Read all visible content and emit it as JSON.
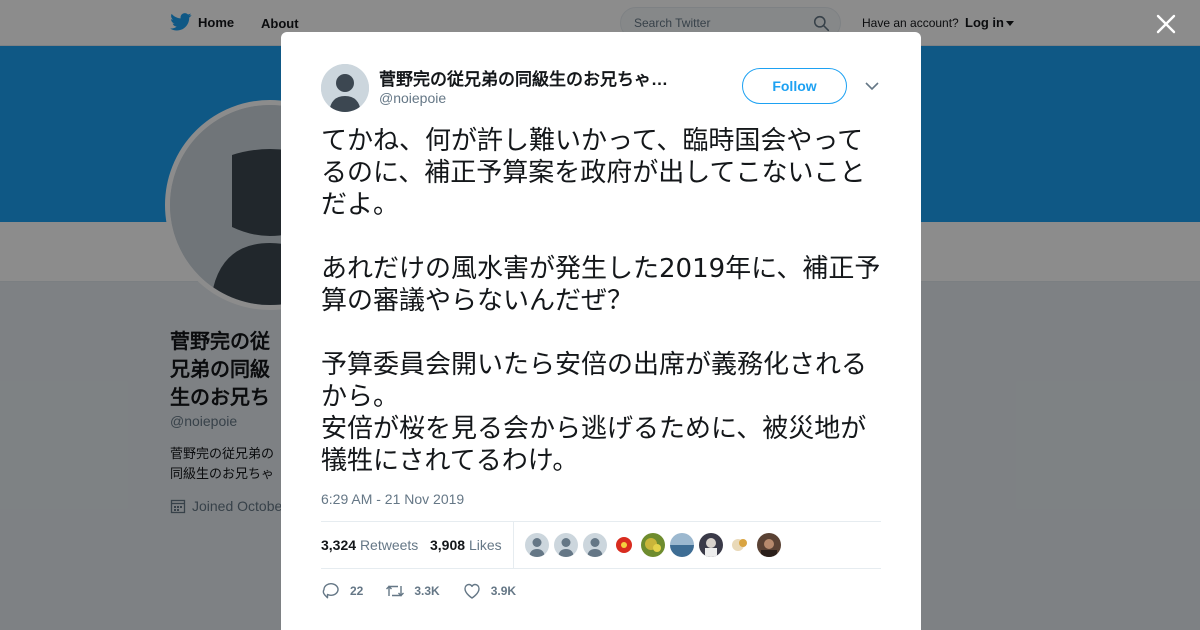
{
  "topbar": {
    "home_label": "Home",
    "about_label": "About",
    "search_placeholder": "Search Twitter",
    "account_prompt": "Have an account?",
    "login_label": "Log in"
  },
  "profile": {
    "name": "菅野完の従兄弟の同級生のお兄ちゃんの友達",
    "handle": "@noiepoie",
    "bio": "菅野完の従兄弟の同級生のお兄ちゃんの彼女の先輩の友達",
    "joined": "Joined October"
  },
  "tweet": {
    "author_name": "菅野完の従兄弟の同級生のお兄ちゃ…",
    "author_handle": "@noiepoie",
    "follow_label": "Follow",
    "paragraphs": [
      "てかね、何が許し難いかって、臨時国会やってるのに、補正予算案を政府が出してこないことだよ。",
      "あれだけの風水害が発生した2019年に、補正予算の審議やらないんだぜ？",
      "予算委員会開いたら安倍の出席が義務化されるから。\n安倍が桜を見る会から逃げるために、被災地が犠牲にされてるわけ。"
    ],
    "timestamp": "6:29 AM - 21 Nov 2019",
    "retweet_count": "3,324",
    "retweet_label": "Retweets",
    "like_count": "3,908",
    "like_label": "Likes",
    "reply_action_count": "22",
    "retweet_action_count": "3.3K",
    "like_action_count": "3.9K"
  },
  "likers": [
    {
      "kind": "default",
      "color": "#ccd6dd"
    },
    {
      "kind": "default",
      "color": "#ccd6dd"
    },
    {
      "kind": "default",
      "color": "#ccd6dd"
    },
    {
      "kind": "flower",
      "color": "#d92c1f"
    },
    {
      "kind": "plant",
      "color": "#c9b53a"
    },
    {
      "kind": "sea",
      "color": "#3e6d94"
    },
    {
      "kind": "portrait",
      "color": "#3a3a48"
    },
    {
      "kind": "drawing",
      "color": "#e9d9b8"
    },
    {
      "kind": "photo",
      "color": "#5a4234"
    }
  ],
  "colors": {
    "accent": "#1da1f2",
    "text": "#14171a",
    "secondary": "#657786"
  }
}
